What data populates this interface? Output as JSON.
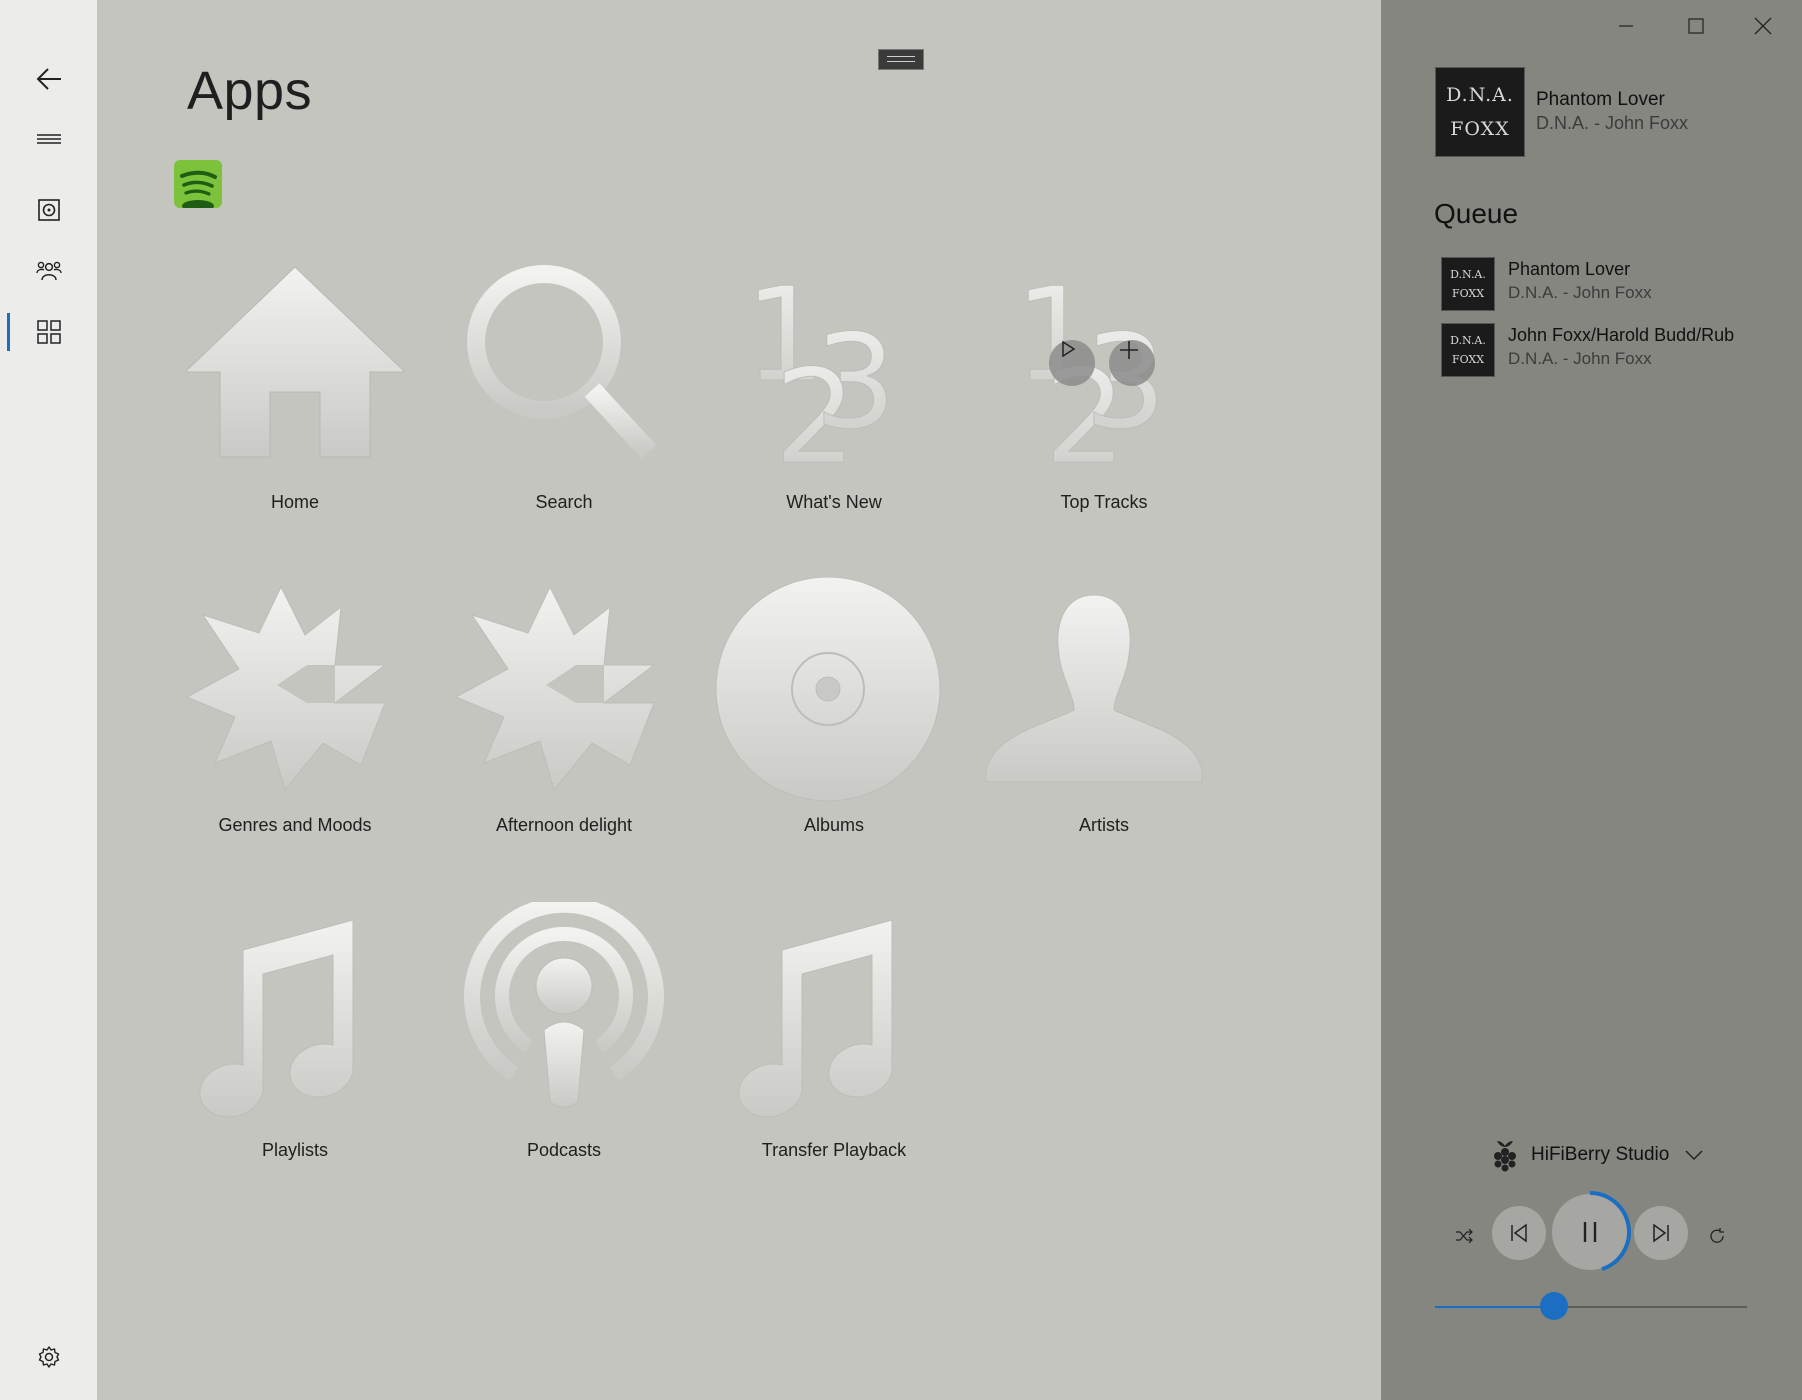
{
  "nav": {
    "items": [
      {
        "name": "back",
        "icon": "back-arrow-icon"
      },
      {
        "name": "menu",
        "icon": "hamburger-icon"
      },
      {
        "name": "now-playing",
        "icon": "speaker-icon"
      },
      {
        "name": "zones",
        "icon": "people-icon"
      },
      {
        "name": "apps",
        "icon": "grid-icon",
        "selected": true
      }
    ],
    "settings_icon": "gear-icon",
    "accent": "#1b6ec2"
  },
  "page": {
    "title": "Apps"
  },
  "apps": {
    "provider_icon": "spotify-logo",
    "tiles": [
      {
        "label": "Home",
        "icon": "house-icon"
      },
      {
        "label": "Search",
        "icon": "magnifier-icon"
      },
      {
        "label": "What's New",
        "icon": "numbers-123-icon"
      },
      {
        "label": "Top Tracks",
        "icon": "numbers-123-icon"
      },
      {
        "label": "Genres and Moods",
        "icon": "starburst-icon"
      },
      {
        "label": "Afternoon delight",
        "icon": "starburst-icon"
      },
      {
        "label": "Albums",
        "icon": "disc-icon"
      },
      {
        "label": "Artists",
        "icon": "person-icon"
      },
      {
        "label": "Playlists",
        "icon": "music-note-icon"
      },
      {
        "label": "Podcasts",
        "icon": "podcast-icon"
      },
      {
        "label": "Transfer Playback",
        "icon": "music-note-icon"
      }
    ]
  },
  "now_playing": {
    "album_art_text": [
      "D.N.A.",
      "FOXX"
    ],
    "title": "Phantom Lover",
    "artist": "D.N.A. - John Foxx"
  },
  "queue": {
    "heading": "Queue",
    "items": [
      {
        "title": "Phantom Lover",
        "artist": "D.N.A. - John Foxx"
      },
      {
        "title": "John Foxx/Harold Budd/Rub",
        "artist": "D.N.A. - John Foxx"
      }
    ]
  },
  "player": {
    "device": "HiFiBerry Studio",
    "device_icon": "raspberry-pi-icon",
    "progress_fraction": 0.45,
    "volume_fraction": 0.38
  }
}
